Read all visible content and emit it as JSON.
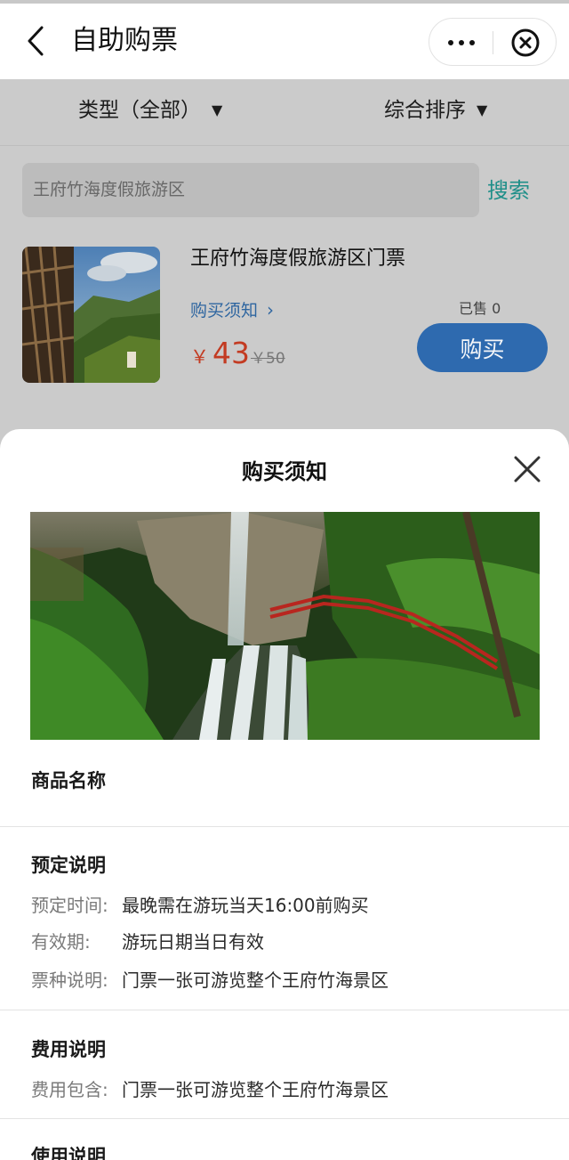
{
  "header": {
    "title": "自助购票"
  },
  "filters": {
    "type_label": "类型（全部）",
    "sort_label": "综合排序",
    "arrow": "▼"
  },
  "search": {
    "value": "王府竹海度假旅游区",
    "button_label": "搜索"
  },
  "product": {
    "name": "王府竹海度假旅游区门票",
    "notice_link": "购买须知",
    "currency": "￥",
    "price": "43",
    "original_price": "￥50",
    "sold": "已售 0",
    "buy_label": "购买"
  },
  "sheet": {
    "title": "购买须知",
    "sections": {
      "product_name": {
        "title": "商品名称"
      },
      "booking": {
        "title": "预定说明",
        "rows": [
          {
            "key": "预定时间:",
            "value": "最晚需在游玩当天16:00前购买"
          },
          {
            "key": "有效期:",
            "value": "游玩日期当日有效"
          },
          {
            "key": "票种说明:",
            "value": "门票一张可游览整个王府竹海景区"
          }
        ]
      },
      "fees": {
        "title": "费用说明",
        "rows": [
          {
            "key": "费用包含:",
            "value": "门票一张可游览整个王府竹海景区"
          }
        ]
      },
      "usage": {
        "title": "使用说明"
      }
    }
  },
  "colors": {
    "accent_teal": "#1f8f89",
    "price_red": "#c33b22",
    "link_blue": "#2f66a0",
    "buy_button": "#2e6aaf",
    "overlay_gray": "#cbcbcb"
  }
}
